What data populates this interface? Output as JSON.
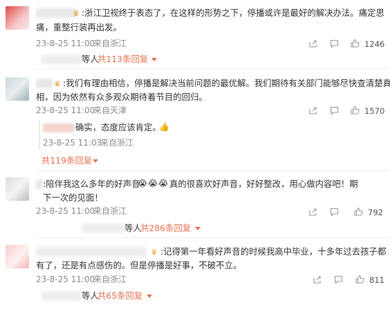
{
  "comments": [
    {
      "line1": "浙江卫视终于表态了，在这样的形势之下，停播或许是最好的解决办法。痛定思",
      "line2": "痛，重整行装再出发。",
      "date": "23-8-25 11:00",
      "location": "来自浙江",
      "likes": "1246",
      "replies_prefix": "等人",
      "replies_link": "共113条回复"
    },
    {
      "line1": "我们有理由相信，停播是解决当前问题的最优解。我们期待有关部门能够尽快查清楚真",
      "line2": "相，因为依然有众多观众期待着节目的回归。",
      "date": "23-8-25 11:00",
      "location": "来自天津",
      "likes": "1570",
      "sub_reply": {
        "text": "确实，态度应该肯定。",
        "emoji": "👍",
        "date": "23-8-25 11:03",
        "location": "来自浙江"
      },
      "replies_link": "共119条回复"
    },
    {
      "line1": "陪伴我这么多年的好声音",
      "emojis": [
        "😭",
        "😭",
        "😭"
      ],
      "line1b": "真的很喜欢好声音，好好整改，用心做内容吧！期",
      "line2": "下一次的见面！",
      "date": "23-8-25 11:00",
      "location": "来自浙江",
      "likes": "792",
      "replies_prefix": "等人",
      "replies_link": "共286条回复"
    },
    {
      "line1": "记得第一年看好声音的时候我高中毕业，十多年过去孩子都",
      "line2": "有了，还是有点感伤的。但是停播是好事，不破不立。",
      "date": "23-8-25 11:00",
      "location": "来自浙江",
      "likes": "811",
      "replies_prefix": "等人",
      "replies_link": "共65条回复"
    }
  ],
  "colors": {
    "accent": "#eb7350",
    "meta": "#8c8c8c",
    "text": "#333333"
  },
  "icons": [
    "crown-badge-icon",
    "share-icon",
    "comment-icon",
    "like-icon",
    "caret-down-icon"
  ]
}
